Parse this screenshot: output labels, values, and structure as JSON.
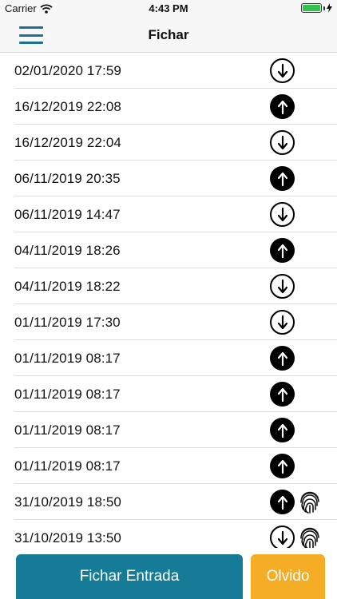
{
  "status_bar": {
    "carrier": "Carrier",
    "time": "4:43 PM",
    "battery_level": 1.0,
    "battery_color": "#33c24d",
    "icons": [
      "wifi-icon",
      "battery-icon",
      "charging-icon"
    ]
  },
  "header": {
    "title": "Fichar",
    "menu_icon": "hamburger-menu-icon",
    "accent": "#1f6f95"
  },
  "records": [
    {
      "date": "02/01/2020 17:59",
      "type": "out",
      "fingerprint": false
    },
    {
      "date": "16/12/2019 22:08",
      "type": "in",
      "fingerprint": false
    },
    {
      "date": "16/12/2019 22:04",
      "type": "out",
      "fingerprint": false
    },
    {
      "date": "06/11/2019 20:35",
      "type": "in",
      "fingerprint": false
    },
    {
      "date": "06/11/2019 14:47",
      "type": "out",
      "fingerprint": false
    },
    {
      "date": "04/11/2019 18:26",
      "type": "in",
      "fingerprint": false
    },
    {
      "date": "04/11/2019 18:22",
      "type": "out",
      "fingerprint": false
    },
    {
      "date": "01/11/2019 17:30",
      "type": "out",
      "fingerprint": false
    },
    {
      "date": "01/11/2019 08:17",
      "type": "in",
      "fingerprint": false
    },
    {
      "date": "01/11/2019 08:17",
      "type": "in",
      "fingerprint": false
    },
    {
      "date": "01/11/2019 08:17",
      "type": "in",
      "fingerprint": false
    },
    {
      "date": "01/11/2019 08:17",
      "type": "in",
      "fingerprint": false
    },
    {
      "date": "31/10/2019 18:50",
      "type": "in",
      "fingerprint": true
    },
    {
      "date": "31/10/2019 13:50",
      "type": "out",
      "fingerprint": true
    }
  ],
  "buttons": {
    "check_in_label": "Fichar Entrada",
    "check_in_color": "#167b96",
    "forgot_label": "Olvido",
    "forgot_color": "#f5ad26"
  }
}
